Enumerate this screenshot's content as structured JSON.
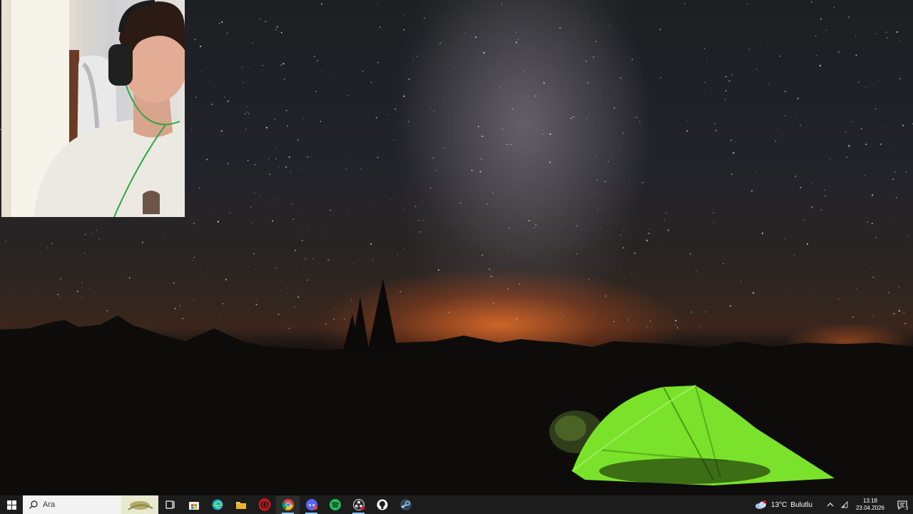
{
  "taskbar": {
    "search_placeholder": "Ara",
    "apps": [
      {
        "name": "task-view",
        "label": ""
      },
      {
        "name": "microsoft-store",
        "label": ""
      },
      {
        "name": "edge",
        "label": ""
      },
      {
        "name": "file-explorer",
        "label": ""
      },
      {
        "name": "opera",
        "label": ""
      },
      {
        "name": "chrome",
        "label": ""
      },
      {
        "name": "discord",
        "label": ""
      },
      {
        "name": "spotify",
        "label": ""
      },
      {
        "name": "obs",
        "label": ""
      },
      {
        "name": "github",
        "label": ""
      },
      {
        "name": "steam",
        "label": ""
      }
    ],
    "weather": {
      "temp": "13°C",
      "condition": "Bulutlu"
    },
    "clock": {
      "time": "13:18",
      "date": "23.04.2026"
    },
    "notification_count": "3"
  },
  "colors": {
    "taskbar_bg": "#1c1c1c",
    "accent": "#0078d4",
    "tent": "#7be22c"
  }
}
